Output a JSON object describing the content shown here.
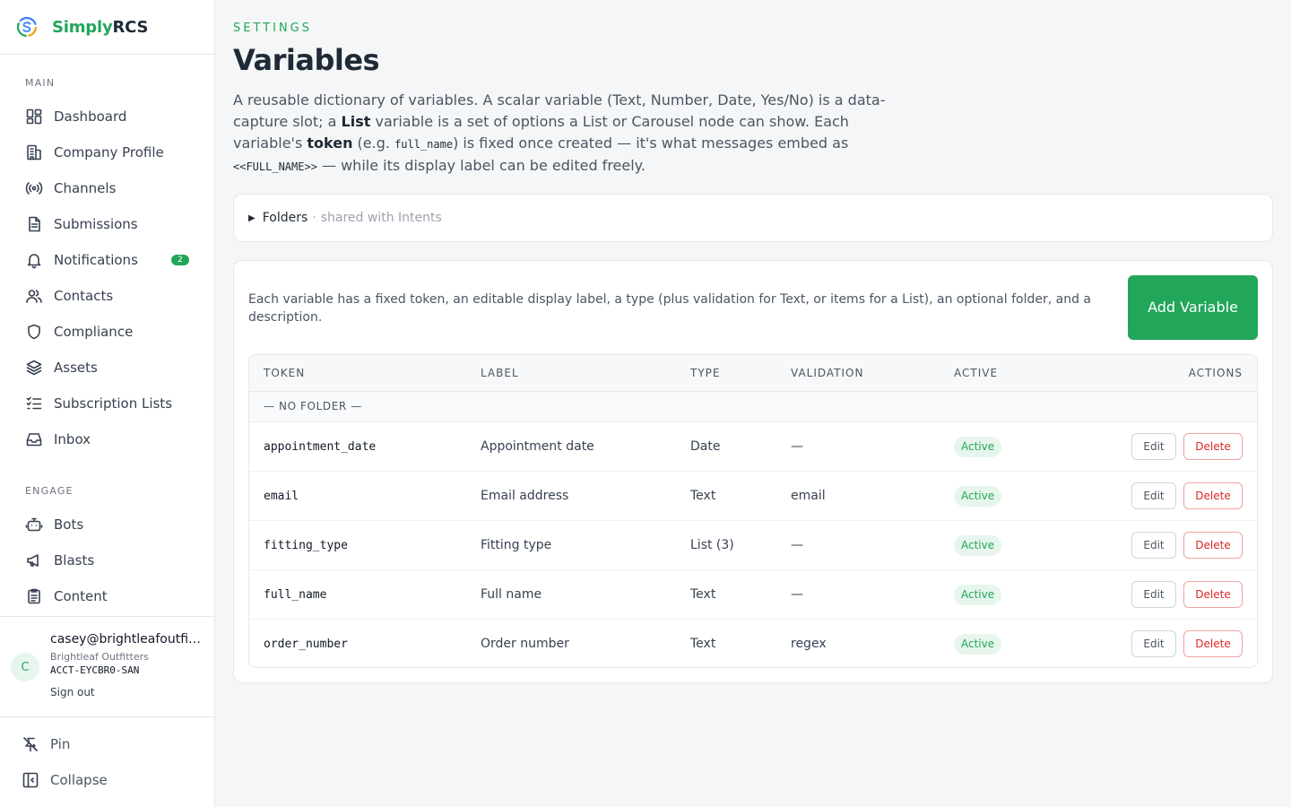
{
  "brand": {
    "simply": "Simply",
    "rcs": "RCS"
  },
  "nav": {
    "main_title": "MAIN",
    "main_items": [
      {
        "label": "Dashboard",
        "icon": "dashboard-icon"
      },
      {
        "label": "Company Profile",
        "icon": "building-icon"
      },
      {
        "label": "Channels",
        "icon": "broadcast-icon"
      },
      {
        "label": "Submissions",
        "icon": "document-icon"
      },
      {
        "label": "Notifications",
        "icon": "bell-icon",
        "badge": "2"
      },
      {
        "label": "Contacts",
        "icon": "users-icon"
      },
      {
        "label": "Compliance",
        "icon": "shield-icon"
      },
      {
        "label": "Assets",
        "icon": "layers-icon"
      },
      {
        "label": "Subscription Lists",
        "icon": "list-check-icon"
      },
      {
        "label": "Inbox",
        "icon": "inbox-icon"
      }
    ],
    "engage_title": "ENGAGE",
    "engage_items": [
      {
        "label": "Bots",
        "icon": "bot-icon"
      },
      {
        "label": "Blasts",
        "icon": "megaphone-icon"
      },
      {
        "label": "Content",
        "icon": "clipboard-icon"
      }
    ]
  },
  "user": {
    "initial": "C",
    "email": "casey@brightleafoutfitters.com",
    "company": "Brightleaf Outfitters",
    "account": "ACCT-EYCBR0-SAN",
    "sign_out": "Sign out"
  },
  "footer": {
    "pin": "Pin",
    "collapse": "Collapse"
  },
  "page": {
    "eyebrow": "SETTINGS",
    "title": "Variables",
    "desc": {
      "p1": "A reusable dictionary of variables. A scalar variable (Text, Number, Date, Yes/No) is a data-capture slot; a ",
      "b1": "List",
      "p2": " variable is a set of options a List or Carousel node can show. Each variable's ",
      "b2": "token",
      "p3": " (e.g. ",
      "code1": "full_name",
      "p4": ") is fixed once created — it's what messages embed as ",
      "code2": "<<FULL_NAME>>",
      "p5": " — while its display label can be edited freely."
    }
  },
  "folders": {
    "caret": "▶",
    "label": "Folders",
    "sep": "·",
    "note": "shared with Intents"
  },
  "vars": {
    "intro": "Each variable has a fixed token, an editable display label, a type (plus validation for Text, or items for a List), an optional folder, and a description.",
    "add_button": "Add Variable",
    "headers": {
      "token": "TOKEN",
      "label": "LABEL",
      "type": "TYPE",
      "validation": "VALIDATION",
      "active": "ACTIVE",
      "actions": "ACTIONS"
    },
    "folder_group": "— NO FOLDER —",
    "edit_label": "Edit",
    "delete_label": "Delete",
    "rows": [
      {
        "token": "appointment_date",
        "label": "Appointment date",
        "type": "Date",
        "validation": "—",
        "active": "Active"
      },
      {
        "token": "email",
        "label": "Email address",
        "type": "Text",
        "validation": "email",
        "active": "Active"
      },
      {
        "token": "fitting_type",
        "label": "Fitting type",
        "type": "List (3)",
        "validation": "—",
        "active": "Active"
      },
      {
        "token": "full_name",
        "label": "Full name",
        "type": "Text",
        "validation": "—",
        "active": "Active"
      },
      {
        "token": "order_number",
        "label": "Order number",
        "type": "Text",
        "validation": "regex",
        "active": "Active"
      }
    ]
  },
  "colors": {
    "accent": "#22a65a",
    "danger": "#dc2626",
    "title": "#1f2a37"
  }
}
